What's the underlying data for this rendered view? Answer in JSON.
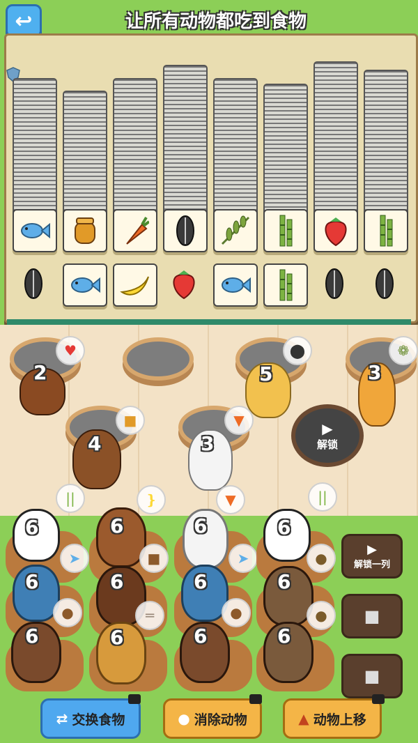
{
  "header": {
    "title": "让所有动物都吃到食物",
    "back_icon": "back-arrow-icon"
  },
  "board": {
    "columns": [
      {
        "top_tile": "fish",
        "loose": "sunflower-seed"
      },
      {
        "top_tile": "honey",
        "loose": "fish"
      },
      {
        "top_tile": "carrot",
        "loose": "banana"
      },
      {
        "top_tile": "sunflower-seed",
        "loose": "strawberry"
      },
      {
        "top_tile": "leaf-branch",
        "loose": "fish"
      },
      {
        "top_tile": "bamboo",
        "loose": "bamboo"
      },
      {
        "top_tile": "strawberry",
        "loose": "sunflower-seed"
      },
      {
        "top_tile": "bamboo",
        "loose": "sunflower-seed"
      }
    ]
  },
  "tables": [
    {
      "count": "2",
      "want": "strawberry",
      "animal": "hedgehog"
    },
    {
      "count": "",
      "want": "",
      "animal": "empty"
    },
    {
      "count": "5",
      "want": "sunflower-seed",
      "animal": "hamster"
    },
    {
      "count": "3",
      "want": "leaf-branch",
      "animal": "giraffe"
    },
    {
      "count": "4",
      "want": "honey",
      "animal": "bear"
    },
    {
      "count": "3",
      "want": "carrot",
      "animal": "rabbit"
    }
  ],
  "unlock_table": {
    "label": "解锁",
    "icon": "video-camera-icon"
  },
  "queue": {
    "columns": [
      {
        "items": [
          {
            "count": "6",
            "animal": "panda",
            "want": "bamboo"
          },
          {
            "count": "6",
            "animal": "blue-cat",
            "want": "fish"
          },
          {
            "count": "6",
            "animal": "red-squirrel",
            "want": "acorn"
          }
        ]
      },
      {
        "items": [
          {
            "count": "6",
            "animal": "monkey",
            "want": "banana"
          },
          {
            "count": "6",
            "animal": "brown-bear",
            "want": "honey"
          },
          {
            "count": "6",
            "animal": "dog",
            "want": "bone"
          }
        ]
      },
      {
        "items": [
          {
            "count": "6",
            "animal": "rabbit",
            "want": "carrot"
          },
          {
            "count": "6",
            "animal": "blue-cat",
            "want": "fish"
          },
          {
            "count": "6",
            "animal": "red-squirrel",
            "want": "acorn"
          }
        ]
      },
      {
        "items": [
          {
            "count": "6",
            "animal": "panda",
            "want": "bamboo"
          },
          {
            "count": "6",
            "animal": "capybara",
            "want": "seed"
          },
          {
            "count": "6",
            "animal": "capybara",
            "want": "seed"
          }
        ]
      }
    ]
  },
  "side_buttons": [
    {
      "label": "解锁一列",
      "icon": "video-camera-icon"
    },
    {
      "label": "",
      "icon": "lock-icon"
    },
    {
      "label": "",
      "icon": "lock-icon"
    }
  ],
  "bottom_buttons": [
    {
      "label": "交换食物",
      "icon": "shuffle-icon",
      "color": "#4fa8ef"
    },
    {
      "label": "消除动物",
      "icon": "lightbulb-icon",
      "color": "#f4b547"
    },
    {
      "label": "动物上移",
      "icon": "box-arrow-up-icon",
      "color": "#f4b547"
    }
  ]
}
